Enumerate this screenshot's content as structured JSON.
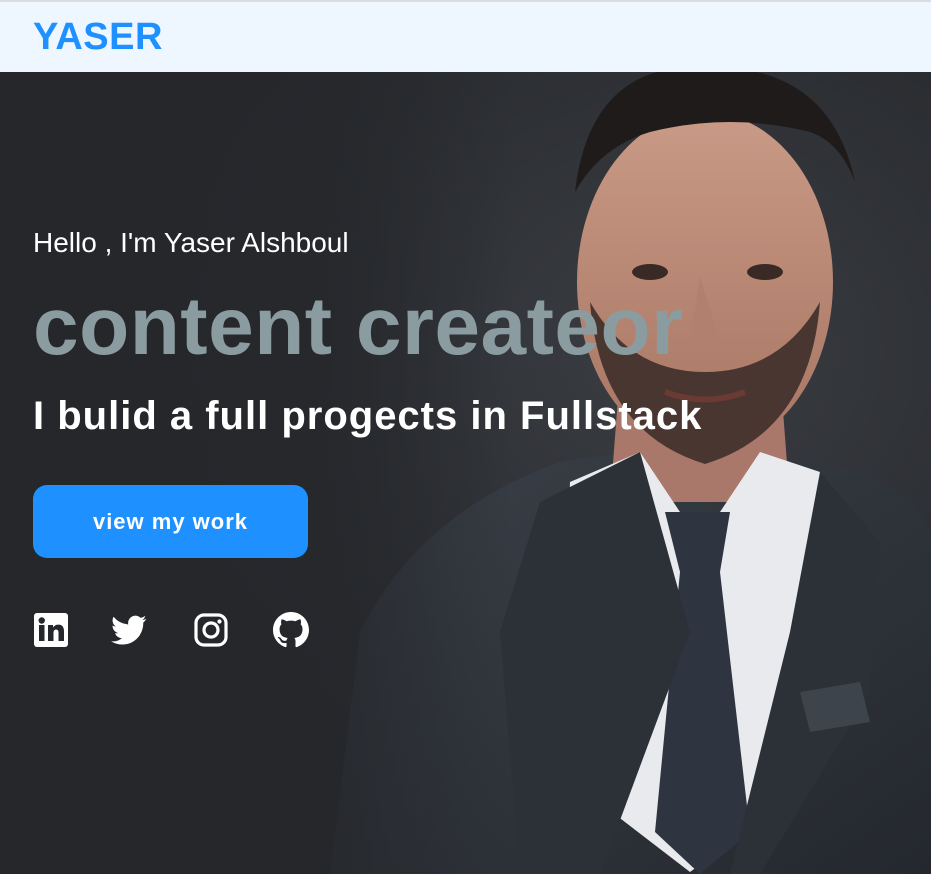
{
  "navbar": {
    "logo": "YASER"
  },
  "hero": {
    "greeting": "Hello , I'm Yaser Alshboul",
    "role": "content createor",
    "tagline": "I bulid a full progects in Fullstack",
    "cta_label": "view my work",
    "photo": {
      "icon": "profile-photo"
    },
    "socials": [
      {
        "name": "linkedin",
        "icon": "linkedin-icon"
      },
      {
        "name": "twitter",
        "icon": "twitter-icon"
      },
      {
        "name": "instagram",
        "icon": "instagram-icon"
      },
      {
        "name": "github",
        "icon": "github-icon"
      }
    ]
  },
  "colors": {
    "accent": "#1e90ff",
    "navbar_bg": "#eef6ff",
    "hero_bg": "#25272b",
    "role_text": "#8a9ca0",
    "text": "#ffffff"
  }
}
